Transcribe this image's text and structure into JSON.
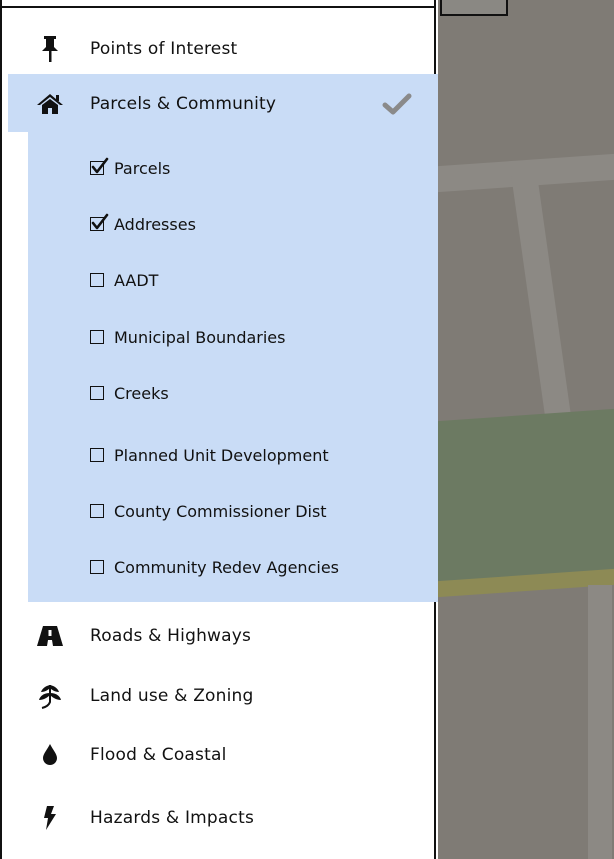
{
  "categories_top": [
    {
      "id": "points",
      "label": "Points of Interest",
      "icon": "pushpin-icon"
    },
    {
      "id": "parcels",
      "label": "Parcels & Community",
      "icon": "home-icon",
      "active": true
    }
  ],
  "sublayers": [
    {
      "label": "Parcels",
      "checked": true
    },
    {
      "label": "Addresses",
      "checked": true
    },
    {
      "label": "AADT",
      "checked": false
    },
    {
      "label": "Municipal Boundaries",
      "checked": false
    },
    {
      "label": "Creeks",
      "checked": false
    },
    {
      "label": "Planned Unit Development",
      "checked": false
    },
    {
      "label": "County Commissioner Dist",
      "checked": false
    },
    {
      "label": "Community Redev Agencies",
      "checked": false
    }
  ],
  "categories_bottom": [
    {
      "id": "roads",
      "label": "Roads & Highways",
      "icon": "road-icon"
    },
    {
      "id": "landuse",
      "label": "Land use & Zoning",
      "icon": "leaf-icon"
    },
    {
      "id": "flood",
      "label": "Flood & Coastal",
      "icon": "water-drop-icon"
    },
    {
      "id": "hazards",
      "label": "Hazards & Impacts",
      "icon": "lightning-icon"
    }
  ],
  "colors": {
    "active": "#c9dcf6",
    "map": "#7f7b75",
    "check": "#8a8a8a"
  }
}
